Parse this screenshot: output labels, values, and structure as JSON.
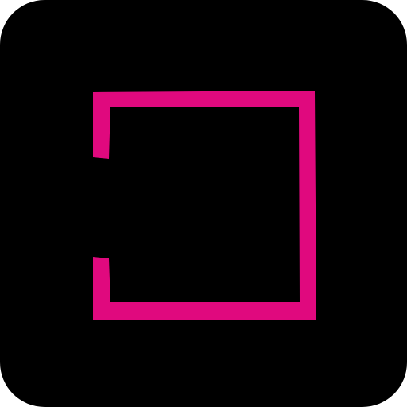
{
  "icon": {
    "semantic_name": "open-bracket-frame-icon",
    "colors": {
      "background": "#000000",
      "accent": "#e0097e"
    }
  }
}
